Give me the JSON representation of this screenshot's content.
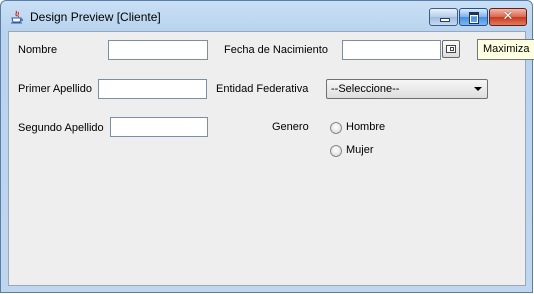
{
  "window": {
    "title": "Design Preview [Cliente]",
    "icon": "java-coffee-icon",
    "controls": {
      "minimize_icon": "minimize-icon",
      "maximize_icon": "maximize-icon",
      "close_icon": "close-icon",
      "close_glyph": "✕"
    },
    "tooltip": "Maximiza"
  },
  "form": {
    "nombre": {
      "label": "Nombre",
      "value": ""
    },
    "primer_apellido": {
      "label": "Primer Apellido",
      "value": ""
    },
    "segundo_apellido": {
      "label": "Segundo Apellido",
      "value": ""
    },
    "fecha_nacimiento": {
      "label": "Fecha de Nacimiento",
      "value": "",
      "picker_icon": "calendar-icon"
    },
    "entidad_federativa": {
      "label": "Entidad Federativa",
      "selected": "--Seleccione--"
    },
    "genero": {
      "label": "Genero",
      "options": [
        {
          "label": "Hombre",
          "checked": false
        },
        {
          "label": "Mujer",
          "checked": false
        }
      ]
    }
  }
}
